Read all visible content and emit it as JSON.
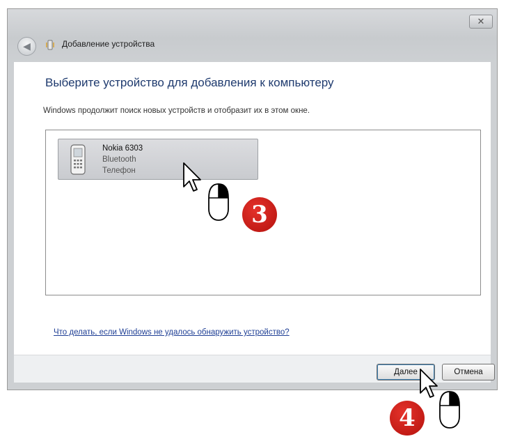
{
  "window": {
    "title": "Добавление устройства",
    "close_label": "✕"
  },
  "content": {
    "heading": "Выберите устройство для добавления к компьютеру",
    "instruction": "Windows продолжит поиск новых устройств и отобразит их в этом окне.",
    "devices": [
      {
        "name": "Nokia 6303",
        "connection": "Bluetooth",
        "type": "Телефон",
        "icon": "phone-icon"
      }
    ],
    "help_link": "Что делать, если Windows не удалось обнаружить устройство?"
  },
  "footer": {
    "next_label": "Далее",
    "cancel_label": "Отмена"
  },
  "annotations": {
    "step_3": "3",
    "step_4": "4",
    "colors": {
      "badge": "#c8150f",
      "accent": "#1e3a6e"
    }
  }
}
